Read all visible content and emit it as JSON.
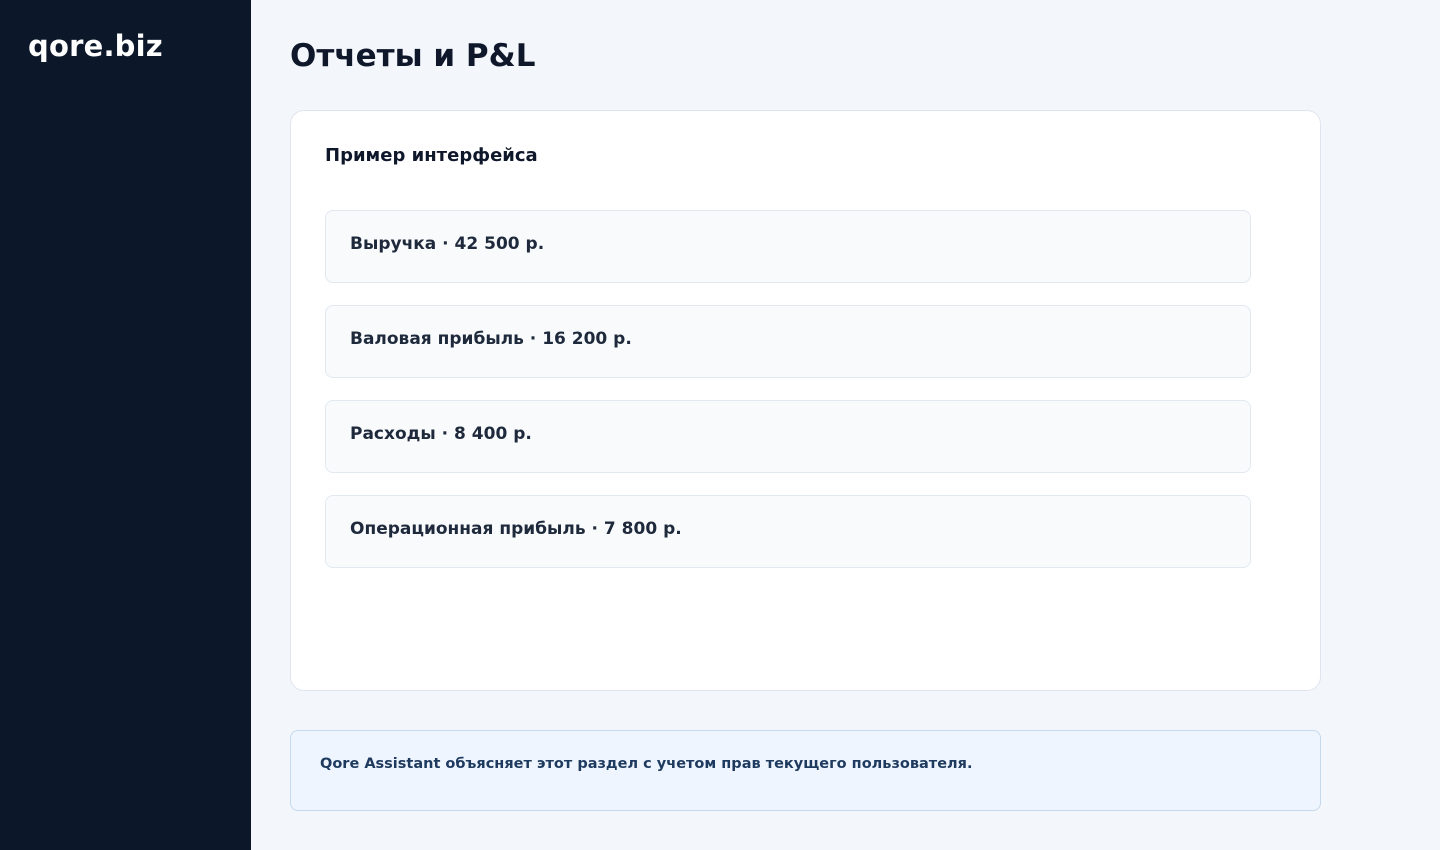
{
  "sidebar": {
    "brand": "qore.biz"
  },
  "main": {
    "title": "Отчеты и P&L",
    "panel": {
      "title": "Пример интерфейса",
      "metrics": [
        {
          "text": "Выручка · 42 500 р."
        },
        {
          "text": "Валовая прибыль · 16 200 р."
        },
        {
          "text": "Расходы · 8 400 р."
        },
        {
          "text": "Операционная прибыль · 7 800 р."
        }
      ]
    },
    "assistant_note": "Qore Assistant объясняет этот раздел с учетом прав текущего пользователя."
  },
  "colors": {
    "sidebar_bg": "#0c1829",
    "page_bg": "#f3f6fb",
    "assistant_bg": "#eef5ff"
  }
}
